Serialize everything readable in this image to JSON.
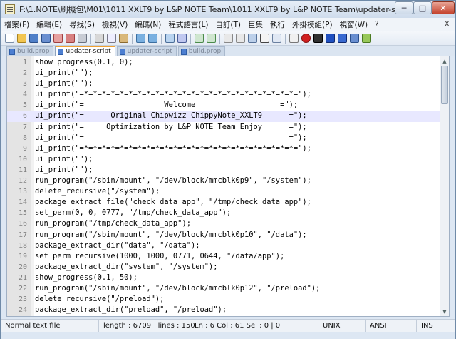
{
  "window": {
    "title": "F:\\1.NOTE\\刷機包\\M01\\1011 XXLT9 by L&P NOTE Team\\1011 XXLT9 by L&P NOTE Team\\updater-script - Note...",
    "min_label": "─",
    "max_label": "□",
    "close_label": "✕"
  },
  "menu": {
    "items": [
      "檔案(F)",
      "編輯(E)",
      "尋找(S)",
      "檢視(V)",
      "編碼(N)",
      "程式語言(L)",
      "自訂(T)",
      "巨集",
      "執行",
      "外掛模組(P)",
      "視窗(W)",
      "?"
    ],
    "close_label": "X"
  },
  "toolbar": {
    "icons": [
      "new-file-icon",
      "open-file-icon",
      "save-icon",
      "save-all-icon",
      "close-icon",
      "close-all-icon",
      "print-icon",
      "cut-icon",
      "copy-icon",
      "paste-icon",
      "undo-icon",
      "redo-icon",
      "find-icon",
      "replace-icon",
      "zoom-in-icon",
      "zoom-out-icon",
      "sync-v-icon",
      "sync-h-icon",
      "wrap-icon",
      "all-chars-icon",
      "indent-guide-icon",
      "lang-icon",
      "record-icon",
      "stop-icon",
      "play-icon",
      "play-multi-icon",
      "save-macro-icon",
      "spell-icon"
    ]
  },
  "tabs": [
    {
      "label": "build.prop",
      "active": false
    },
    {
      "label": "updater-script",
      "active": true
    },
    {
      "label": "updater-script",
      "active": false
    },
    {
      "label": "build.prop",
      "active": false
    }
  ],
  "editor": {
    "current_line": 6,
    "lines": [
      {
        "n": "1",
        "text": "show_progress(0.1, 0);"
      },
      {
        "n": "2",
        "text": "ui_print(\"\");"
      },
      {
        "n": "3",
        "text": "ui_print(\"\");"
      },
      {
        "n": "4",
        "text": "ui_print(\"=*=*=*=*=*=*=*=*=*=*=*=*=*=*=*=*=*=*=*=*=*=*=*=*=\");"
      },
      {
        "n": "5",
        "text": "ui_print(\"=                  Welcome                   =\");"
      },
      {
        "n": "6",
        "text": "ui_print(\"=      Original Chipwizz ChippyNote_XXLT9      =\");"
      },
      {
        "n": "7",
        "text": "ui_print(\"=     Optimization by L&P NOTE Team Enjoy      =\");"
      },
      {
        "n": "8",
        "text": "ui_print(\"=                                              =\");"
      },
      {
        "n": "9",
        "text": "ui_print(\"=*=*=*=*=*=*=*=*=*=*=*=*=*=*=*=*=*=*=*=*=*=*=*=*=\");"
      },
      {
        "n": "10",
        "text": "ui_print(\"\");"
      },
      {
        "n": "11",
        "text": "ui_print(\"\");"
      },
      {
        "n": "12",
        "text": "run_program(\"/sbin/mount\", \"/dev/block/mmcblk0p9\", \"/system\");"
      },
      {
        "n": "13",
        "text": "delete_recursive(\"/system\");"
      },
      {
        "n": "14",
        "text": "package_extract_file(\"check_data_app\", \"/tmp/check_data_app\");"
      },
      {
        "n": "15",
        "text": "set_perm(0, 0, 0777, \"/tmp/check_data_app\");"
      },
      {
        "n": "16",
        "text": "run_program(\"/tmp/check_data_app\");"
      },
      {
        "n": "17",
        "text": "run_program(\"/sbin/mount\", \"/dev/block/mmcblk0p10\", \"/data\");"
      },
      {
        "n": "18",
        "text": "package_extract_dir(\"data\", \"/data\");"
      },
      {
        "n": "19",
        "text": "set_perm_recursive(1000, 1000, 0771, 0644, \"/data/app\");"
      },
      {
        "n": "20",
        "text": "package_extract_dir(\"system\", \"/system\");"
      },
      {
        "n": "21",
        "text": "show_progress(0.1, 50);"
      },
      {
        "n": "22",
        "text": "run_program(\"/sbin/mount\", \"/dev/block/mmcblk0p12\", \"/preload\");"
      },
      {
        "n": "23",
        "text": "delete_recursive(\"/preload\");"
      },
      {
        "n": "24",
        "text": "package_extract_dir(\"preload\", \"/preload\");"
      }
    ]
  },
  "status": {
    "file_type": "Normal text file",
    "length": "length : 6709",
    "lines": "lines : 150",
    "position": "Ln : 6   Col : 61   Sel : 0 | 0",
    "eol": "UNIX",
    "encoding": "ANSI",
    "mode": "INS"
  },
  "colors": {
    "current_line": "#e8e8ff",
    "active_tab_accent": "#f0a030",
    "close_button": "#c5442e"
  }
}
